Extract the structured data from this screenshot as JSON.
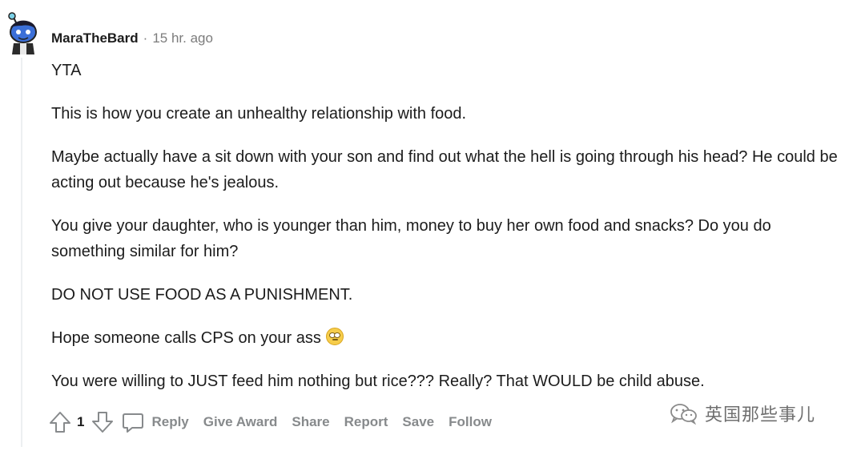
{
  "comment": {
    "author": "MaraTheBard",
    "separator": "·",
    "timestamp": "15 hr. ago",
    "paragraphs": [
      "YTA",
      "This is how you create an unhealthy relationship with food.",
      "Maybe actually have a sit down with your son and find out what the hell is going through his head? He could be acting out because he's jealous.",
      "You give your daughter, who is younger than him, money to buy her own food and snacks? Do you do something similar for him?",
      "DO NOT USE FOOD AS A PUNISHMENT.",
      "Hope someone calls CPS on your ass",
      "You were willing to JUST feed him nothing but rice??? Really? That WOULD be child abuse."
    ],
    "emoji_name": "rolling-eyes-emoji"
  },
  "actions": {
    "vote_count": "1",
    "reply": "Reply",
    "give_award": "Give Award",
    "share": "Share",
    "report": "Report",
    "save": "Save",
    "follow": "Follow"
  },
  "watermark": {
    "text": "英国那些事儿",
    "icon": "wechat-icon"
  },
  "icons": {
    "avatar": "snoo-avatar",
    "upvote": "upvote-arrow-icon",
    "downvote": "downvote-arrow-icon",
    "reply": "comment-bubble-icon"
  },
  "colors": {
    "text": "#1c1c1c",
    "muted": "#878a8c",
    "thread_line": "#edeff1"
  }
}
